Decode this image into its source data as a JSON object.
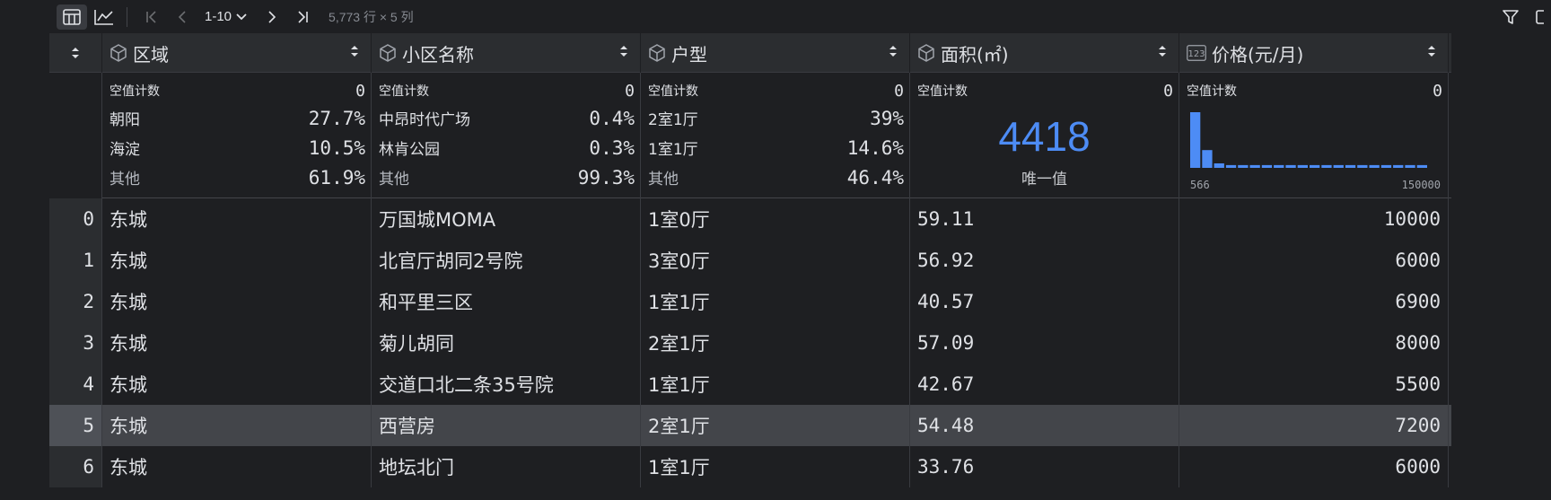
{
  "toolbar": {
    "page_range": "1-10",
    "row_count": "5,773 行 × 5 列",
    "icons": [
      "table-view-icon",
      "chart-view-icon",
      "first-page-icon",
      "prev-page-icon",
      "next-page-icon",
      "last-page-icon",
      "filter-icon"
    ]
  },
  "columns": [
    {
      "name": "区域",
      "type": "text"
    },
    {
      "name": "小区名称",
      "type": "text"
    },
    {
      "name": "户型",
      "type": "text"
    },
    {
      "name": "面积(㎡)",
      "type": "text"
    },
    {
      "name": "价格(元/月)",
      "type": "number",
      "type_badge": "123"
    }
  ],
  "summary": {
    "null_label": "空值计数",
    "col0": {
      "null_count": "0",
      "top": [
        {
          "k": "朝阳",
          "p": "27.7%"
        },
        {
          "k": "海淀",
          "p": "10.5%"
        },
        {
          "k": "其他",
          "p": "61.9%"
        }
      ]
    },
    "col1": {
      "null_count": "0",
      "top": [
        {
          "k": "中昂时代广场",
          "p": "0.4%"
        },
        {
          "k": "林肯公园",
          "p": "0.3%"
        },
        {
          "k": "其他",
          "p": "99.3%"
        }
      ]
    },
    "col2": {
      "null_count": "0",
      "top": [
        {
          "k": "2室1厅",
          "p": "39%"
        },
        {
          "k": "1室1厅",
          "p": "14.6%"
        },
        {
          "k": "其他",
          "p": "46.4%"
        }
      ]
    },
    "col3": {
      "null_count": "0",
      "unique_count": "4418",
      "unique_label": "唯一值"
    },
    "col4": {
      "null_count": "0",
      "hist_min": "566",
      "hist_max": "150000",
      "hist_bars": [
        1.0,
        0.32,
        0.08,
        0.05,
        0.05,
        0.05,
        0.05,
        0.05,
        0.05,
        0.05,
        0.05,
        0.05,
        0.05,
        0.05,
        0.05,
        0.05,
        0.05,
        0.05,
        0.05,
        0.05
      ]
    }
  },
  "rows": [
    {
      "i": "0",
      "a": "东城",
      "b": "万国城MOMA",
      "c": "1室0厅",
      "d": "59.11",
      "e": "10000"
    },
    {
      "i": "1",
      "a": "东城",
      "b": "北官厅胡同2号院",
      "c": "3室0厅",
      "d": "56.92",
      "e": "6000"
    },
    {
      "i": "2",
      "a": "东城",
      "b": "和平里三区",
      "c": "1室1厅",
      "d": "40.57",
      "e": "6900"
    },
    {
      "i": "3",
      "a": "东城",
      "b": "菊儿胡同",
      "c": "2室1厅",
      "d": "57.09",
      "e": "8000"
    },
    {
      "i": "4",
      "a": "东城",
      "b": "交道口北二条35号院",
      "c": "1室1厅",
      "d": "42.67",
      "e": "5500"
    },
    {
      "i": "5",
      "a": "东城",
      "b": "西营房",
      "c": "2室1厅",
      "d": "54.48",
      "e": "7200",
      "selected": true
    },
    {
      "i": "6",
      "a": "东城",
      "b": "地坛北门",
      "c": "1室1厅",
      "d": "33.76",
      "e": "6000"
    }
  ],
  "colors": {
    "accent": "#4d8cf5",
    "bg": "#1e1f22",
    "header_bg": "#2b2d30",
    "selected_row": "#43454a"
  }
}
